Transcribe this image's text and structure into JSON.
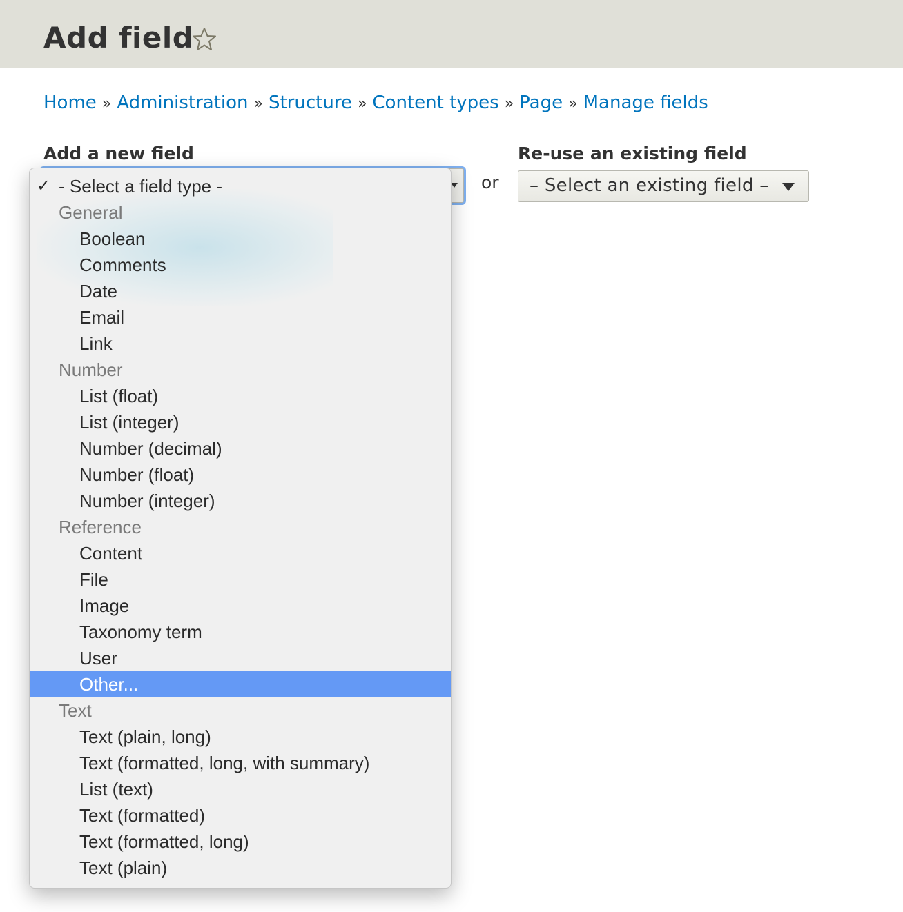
{
  "header": {
    "title": "Add field",
    "star_icon": "star-outline-icon"
  },
  "breadcrumb": {
    "items": [
      "Home",
      "Administration",
      "Structure",
      "Content types",
      "Page",
      "Manage fields"
    ],
    "separator": "»"
  },
  "add_new": {
    "label": "Add a new field",
    "selected": "- Select a field type -"
  },
  "or_text": "or",
  "reuse": {
    "label": "Re-use an existing field",
    "selected": "– Select an existing field –"
  },
  "dropdown": {
    "check_icon": "✓",
    "placeholder": "- Select a field type -",
    "highlighted": "Other...",
    "colors": {
      "highlight": "#6499f5",
      "link": "#0074bd"
    },
    "groups": [
      {
        "label": "General",
        "options": [
          "Boolean",
          "Comments",
          "Date",
          "Email",
          "Link"
        ]
      },
      {
        "label": "Number",
        "options": [
          "List (float)",
          "List (integer)",
          "Number (decimal)",
          "Number (float)",
          "Number (integer)"
        ]
      },
      {
        "label": "Reference",
        "options": [
          "Content",
          "File",
          "Image",
          "Taxonomy term",
          "User",
          "Other..."
        ]
      },
      {
        "label": "Text",
        "options": [
          "Text (plain, long)",
          "Text (formatted, long, with summary)",
          "List (text)",
          "Text (formatted)",
          "Text (formatted, long)",
          "Text (plain)"
        ]
      }
    ]
  }
}
